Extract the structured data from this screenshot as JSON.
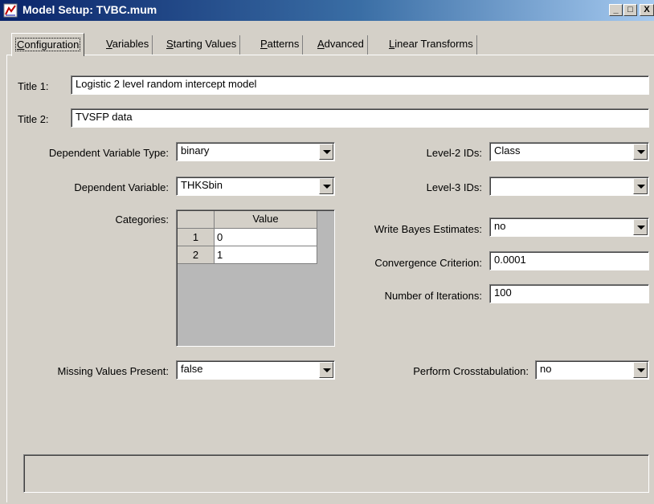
{
  "window": {
    "title": "Model Setup: TVBC.mum",
    "minimize": "_",
    "maximize": "□",
    "close": "X"
  },
  "tabs": [
    {
      "prefix": "",
      "key": "C",
      "rest": "onfiguration"
    },
    {
      "prefix": "",
      "key": "V",
      "rest": "ariables"
    },
    {
      "prefix": "",
      "key": "S",
      "rest": "tarting Values"
    },
    {
      "prefix": "",
      "key": "P",
      "rest": "atterns"
    },
    {
      "prefix": "",
      "key": "A",
      "rest": "dvanced"
    },
    {
      "prefix": "",
      "key": "L",
      "rest": "inear Transforms"
    }
  ],
  "config": {
    "title1_label": "Title 1:",
    "title1_value": "Logistic 2 level random intercept model",
    "title2_label": "Title 2:",
    "title2_value": "TVSFP data",
    "dep_type_label": "Dependent Variable Type:",
    "dep_type_value": "binary",
    "dep_var_label": "Dependent Variable:",
    "dep_var_value": "THKSbin",
    "categories_label": "Categories:",
    "categories": {
      "header": "Value",
      "rows": [
        {
          "num": "1",
          "value": "0"
        },
        {
          "num": "2",
          "value": "1"
        }
      ]
    },
    "missing_label": "Missing Values Present:",
    "missing_value": "false",
    "level2_label": "Level-2 IDs:",
    "level2_value": "Class",
    "level3_label": "Level-3 IDs:",
    "level3_value": "",
    "bayes_label": "Write Bayes Estimates:",
    "bayes_value": "no",
    "convergence_label": "Convergence Criterion:",
    "convergence_value": "0.0001",
    "iterations_label": "Number of Iterations:",
    "iterations_value": "100",
    "crosstab_label": "Perform Crosstabulation:",
    "crosstab_value": "no"
  }
}
